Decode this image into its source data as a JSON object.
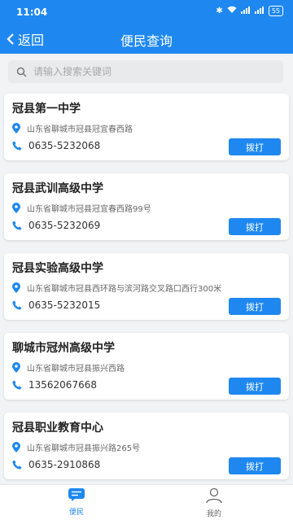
{
  "status_bar": {
    "time": "11:04",
    "signal1": "4G",
    "signal2": "4G",
    "battery": "55"
  },
  "header": {
    "back_label": "返回",
    "title": "便民查询"
  },
  "search": {
    "placeholder": "请输入搜索关键词"
  },
  "call_label": "拨打",
  "items": [
    {
      "name": "冠县第一中学",
      "address": "山东省聊城市冠县冠宜春西路",
      "phone": "0635-5232068"
    },
    {
      "name": "冠县武训高级中学",
      "address": "山东省聊城市冠县冠宜春西路99号",
      "phone": "0635-5232069"
    },
    {
      "name": "冠县实验高级中学",
      "address": "山东省聊城市冠县西环路与滨河路交叉路口西行300米",
      "phone": "0635-5232015"
    },
    {
      "name": "聊城市冠州高级中学",
      "address": "山东省聊城市冠县振兴西路",
      "phone": "13562067668"
    },
    {
      "name": "冠县职业教育中心",
      "address": "山东省聊城市冠县振兴路265号",
      "phone": "0635-2910868"
    }
  ],
  "tabbar": {
    "tab1": "便民",
    "tab2": "我的"
  },
  "colors": {
    "primary": "#1e88f0",
    "background": "#f2f3f5"
  }
}
